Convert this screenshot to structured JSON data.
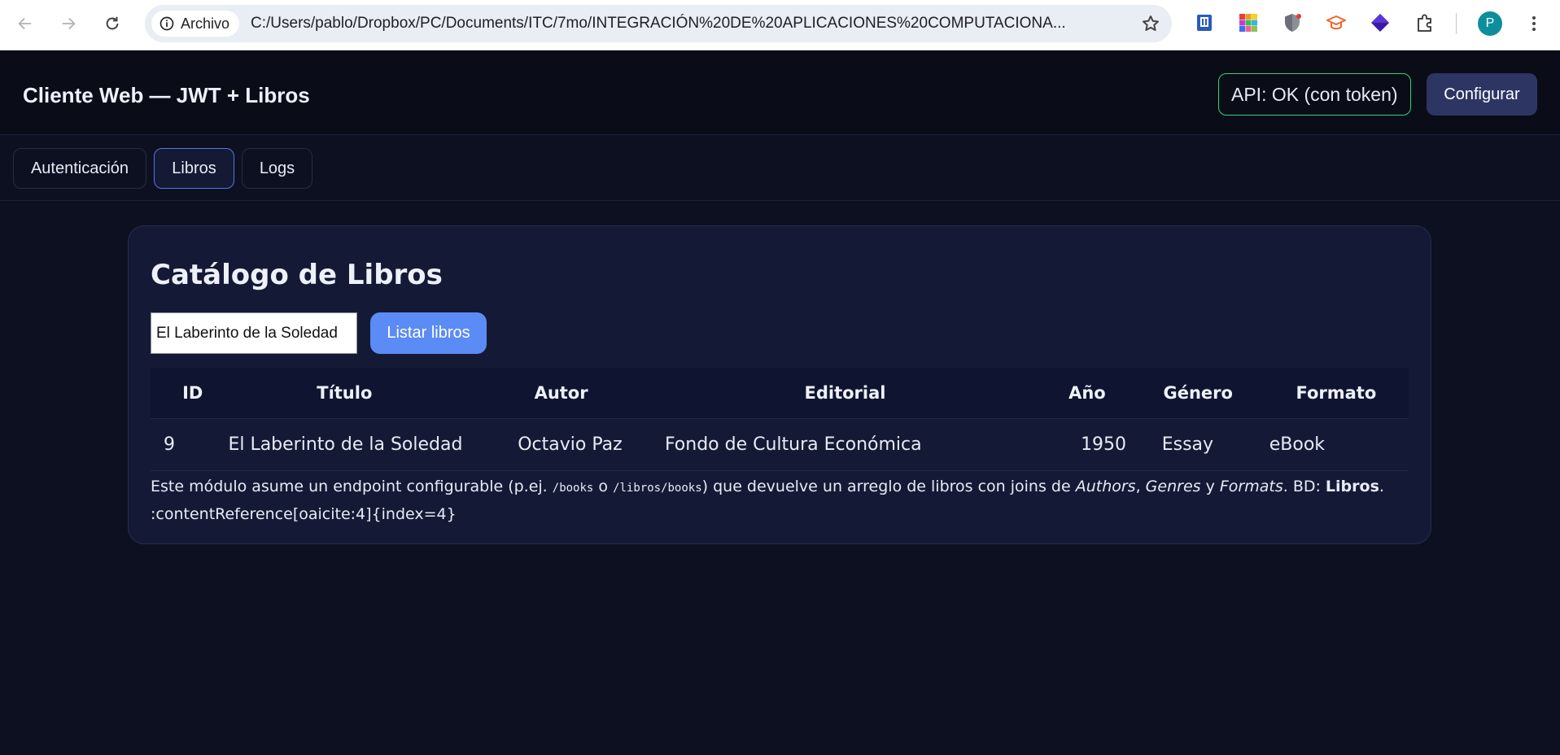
{
  "browser": {
    "site_chip_label": "Archivo",
    "url": "C:/Users/pablo/Dropbox/PC/Documents/ITC/7mo/INTEGRACIÓN%20DE%20APLICACIONES%20COMPUTACIONA...",
    "profile_initial": "P",
    "icons": [
      "back-arrow-icon",
      "forward-arrow-icon",
      "reload-icon",
      "info-icon",
      "star-icon",
      "book-extension-icon",
      "color-grid-extension-icon",
      "shield-extension-icon",
      "graduation-cap-extension-icon",
      "layers-extension-icon",
      "puzzle-icon",
      "more-vert-icon"
    ]
  },
  "header": {
    "title": "Cliente Web — JWT + Libros",
    "api_status": "API: OK (con token)",
    "config_button": "Configurar"
  },
  "tabs": [
    {
      "label": "Autenticación",
      "active": false
    },
    {
      "label": "Libros",
      "active": true
    },
    {
      "label": "Logs",
      "active": false
    }
  ],
  "catalog": {
    "title": "Catálogo de Libros",
    "search_value": "El Laberinto de la Soledad",
    "list_button": "Listar libros",
    "columns": [
      "ID",
      "Título",
      "Autor",
      "Editorial",
      "Año",
      "Género",
      "Formato"
    ],
    "rows": [
      {
        "id": "9",
        "title": "El Laberinto de la Soledad",
        "author": "Octavio Paz",
        "publisher": "Fondo de Cultura Económica",
        "year": "1950",
        "genre": "Essay",
        "format": "eBook"
      }
    ],
    "note": {
      "part1": "Este módulo asume un endpoint configurable (p.ej. ",
      "code1": "/books",
      "part2": " o ",
      "code2": "/libros/books",
      "part3": ") que devuelve un arreglo de libros con joins de ",
      "em1": "Authors",
      "part4": ", ",
      "em2": "Genres",
      "part5": " y ",
      "em3": "Formats",
      "part6": ". BD: ",
      "strong1": "Libros",
      "part7": ".",
      "line2": ":contentReference[oaicite:4]{index=4}"
    }
  },
  "colors": {
    "page_bg": "#0d1021",
    "header_bg": "#0a0c17",
    "card_bg": "#141a36",
    "accent_button": "#5b8cf5",
    "config_button": "#2d3563",
    "status_ok_border": "#34d27a",
    "active_tab_border": "#5577dd"
  }
}
